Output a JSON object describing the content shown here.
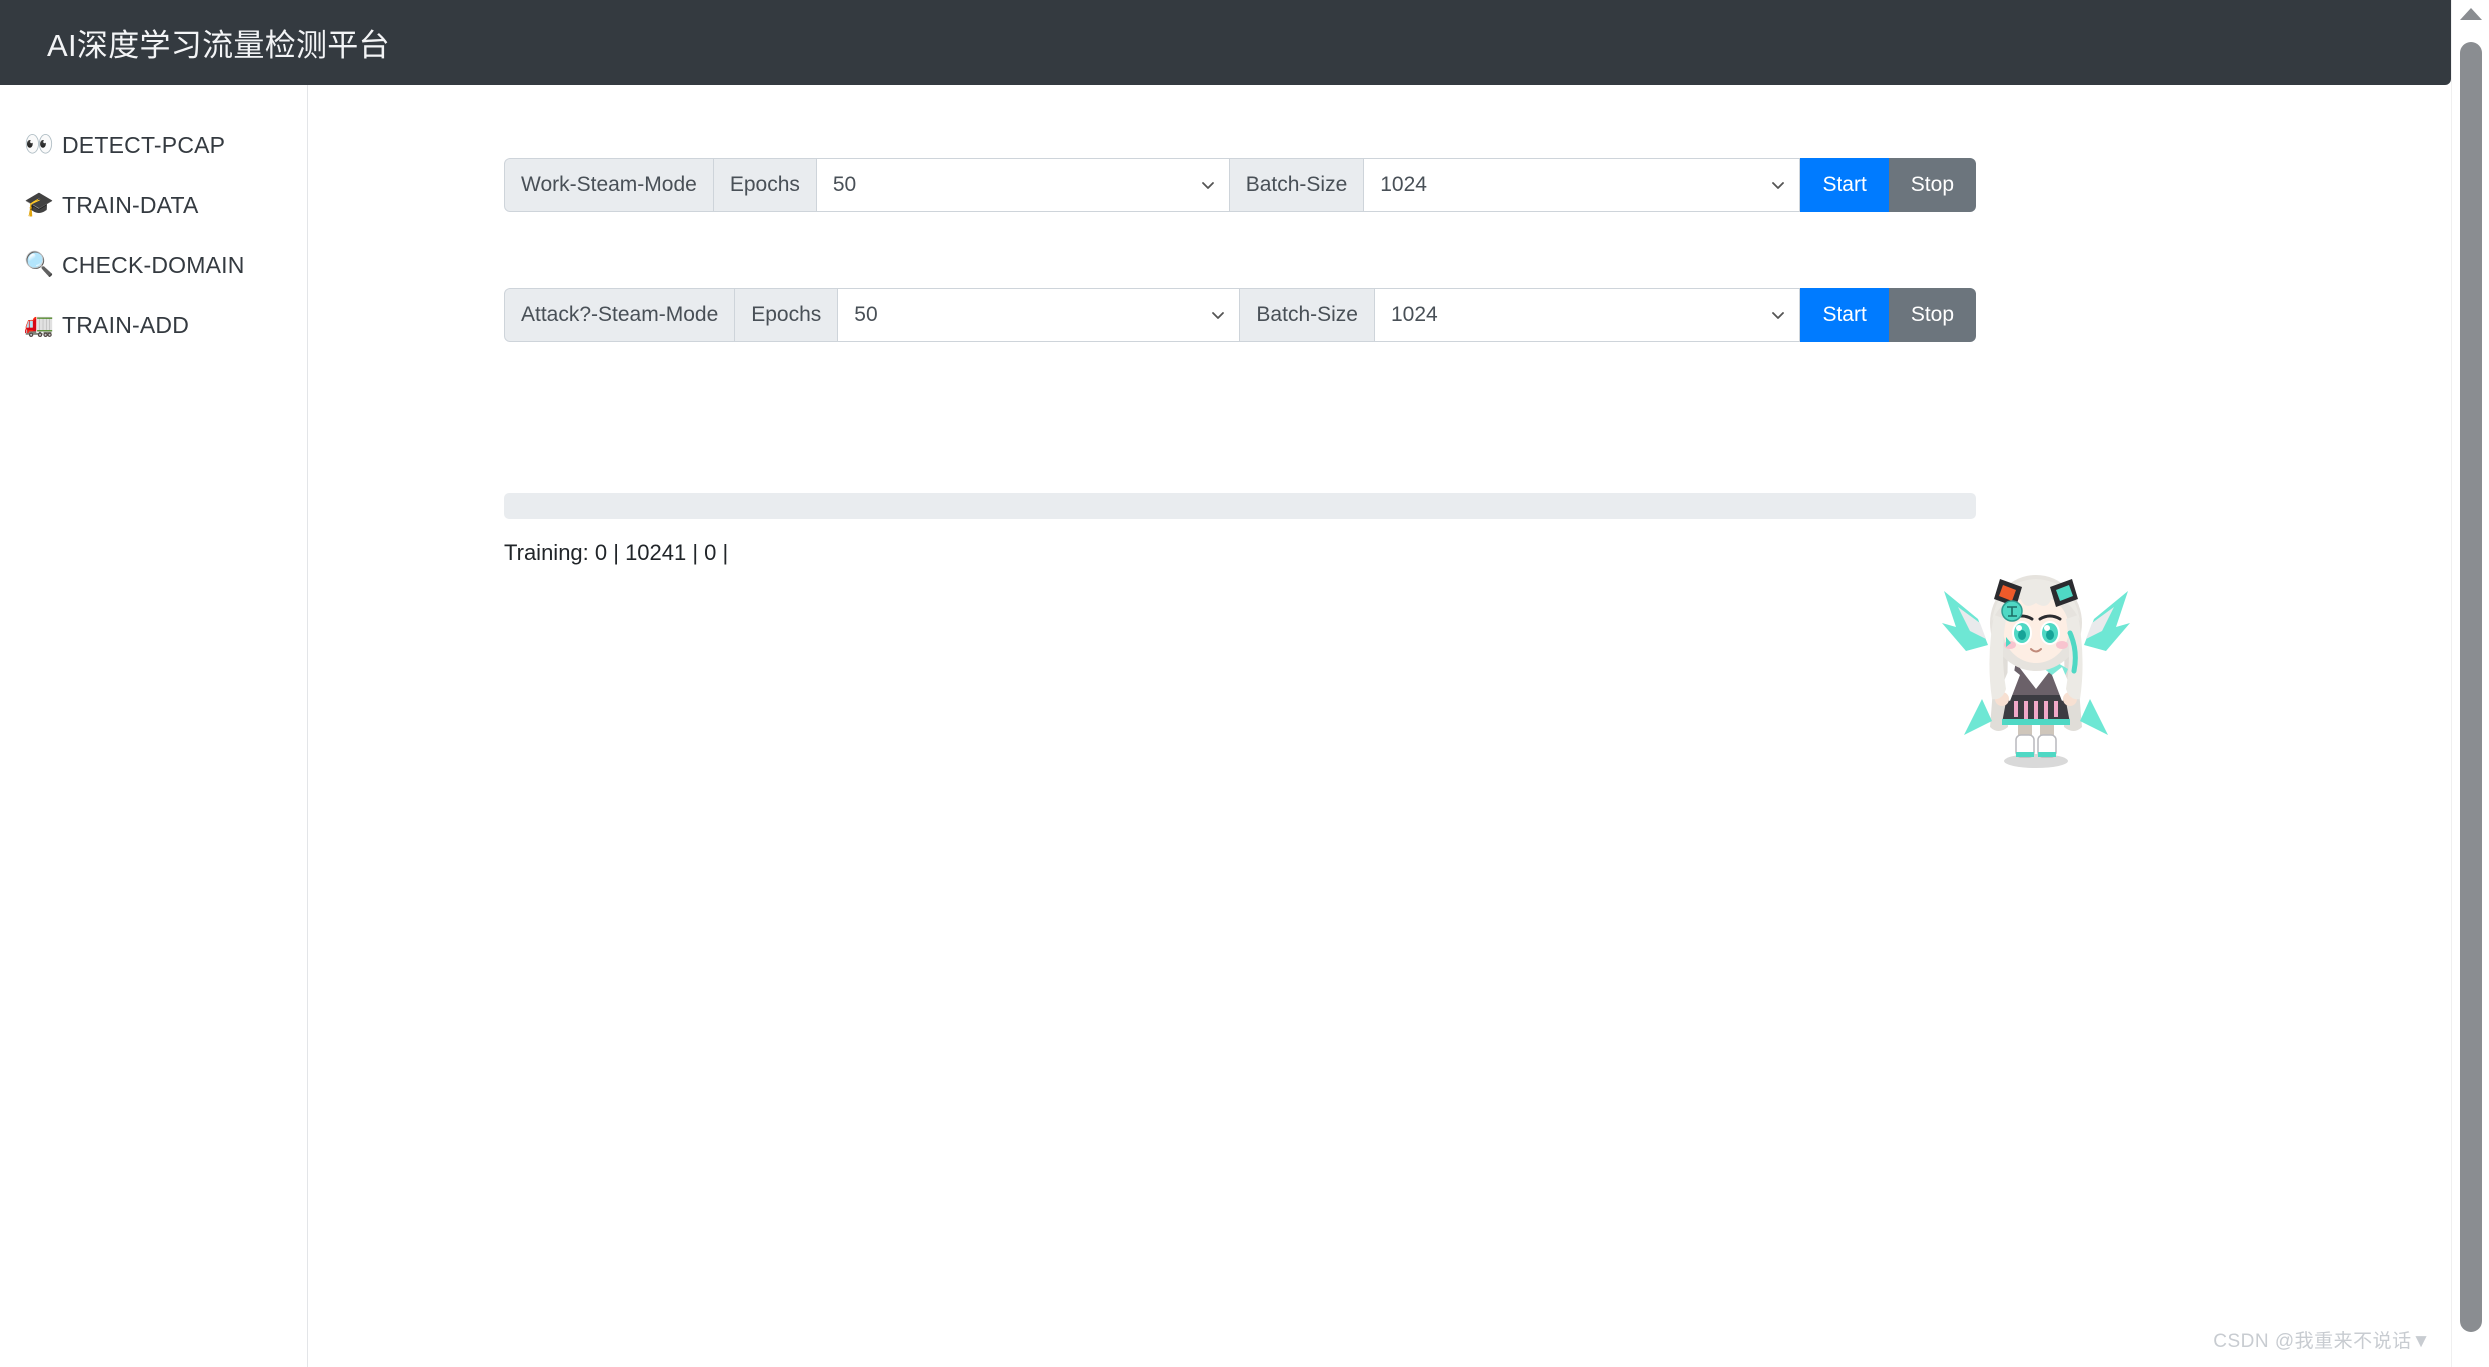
{
  "header": {
    "title": "AI深度学习流量检测平台"
  },
  "sidebar": {
    "items": [
      {
        "icon": "👀",
        "icon_name": "eyes-icon",
        "label": "DETECT-PCAP"
      },
      {
        "icon": "🎓",
        "icon_name": "graduation-cap-icon",
        "label": "TRAIN-DATA"
      },
      {
        "icon": "🔍",
        "icon_name": "magnifier-icon",
        "label": "CHECK-DOMAIN"
      },
      {
        "icon": "🚛",
        "icon_name": "truck-icon",
        "label": "TRAIN-ADD"
      }
    ]
  },
  "main": {
    "rows": [
      {
        "mode_label": "Work-Steam-Mode",
        "epochs_label": "Epochs",
        "epochs_value": "50",
        "batch_label": "Batch-Size",
        "batch_value": "1024",
        "start_label": "Start",
        "stop_label": "Stop"
      },
      {
        "mode_label": "Attack?-Steam-Mode",
        "epochs_label": "Epochs",
        "epochs_value": "50",
        "batch_label": "Batch-Size",
        "batch_value": "1024",
        "start_label": "Start",
        "stop_label": "Stop"
      }
    ],
    "progress": {
      "percent": 0,
      "percent_label": ""
    },
    "status": "Training: 0 | 10241 | 0 |"
  },
  "watermark": "CSDN @我重来不说话▼",
  "colors": {
    "header_bg": "#343a40",
    "start_button": "#007bff",
    "stop_button": "#6c757d",
    "addon_bg": "#e9ecef",
    "progress_track": "#e9ecef"
  }
}
